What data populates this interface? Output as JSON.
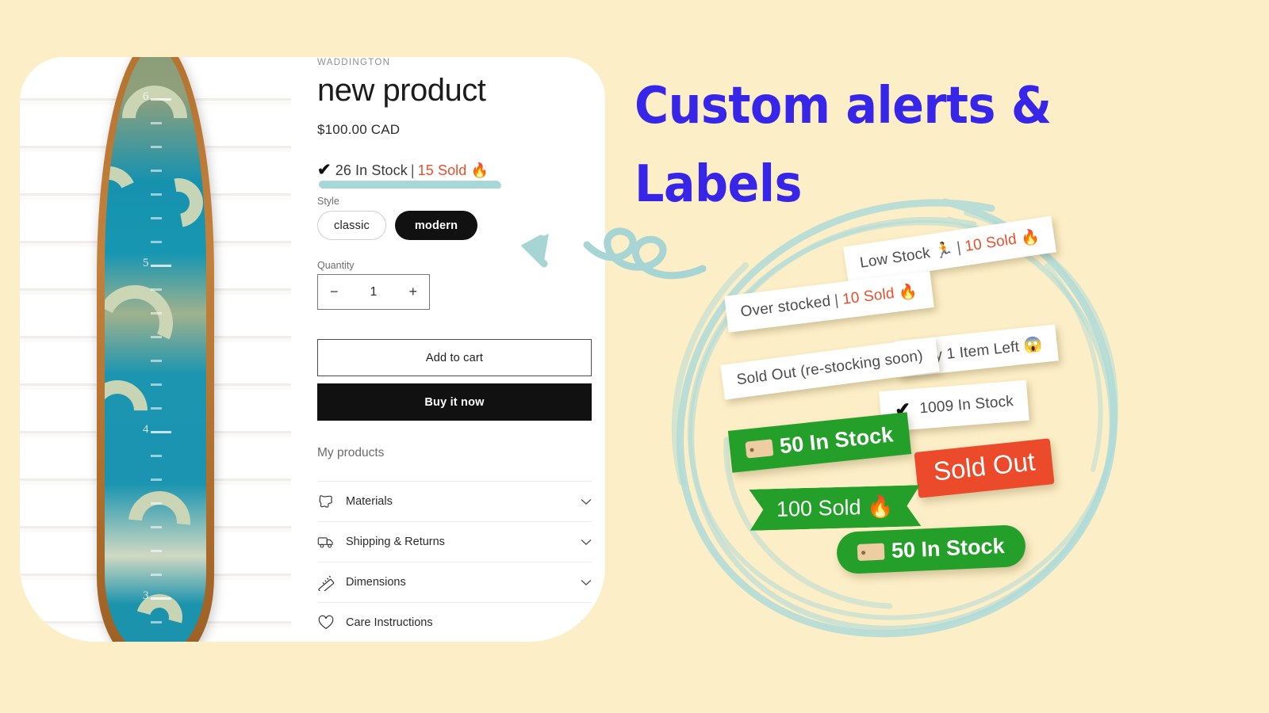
{
  "background_color": "#FCEEC6",
  "heading": {
    "line1": "Custom alerts &",
    "line2": "Labels",
    "color": "#3726E8"
  },
  "product": {
    "vendor": "WADDINGTON",
    "title": "new product",
    "price": "$100.00 CAD",
    "stock_alert": {
      "check_icon": "check-icon",
      "in_stock_text": "26 In Stock",
      "separator": "|",
      "sold_text": "15 Sold",
      "fire_icon": "🔥",
      "sold_color": "#e8502c",
      "underline_color": "#a8d7d7"
    },
    "style": {
      "label": "Style",
      "options": [
        {
          "label": "classic",
          "selected": false
        },
        {
          "label": "modern",
          "selected": true
        }
      ]
    },
    "quantity": {
      "label": "Quantity",
      "value": "1",
      "minus": "−",
      "plus": "+"
    },
    "buttons": {
      "add_to_cart": "Add to cart",
      "buy_it_now": "Buy it now"
    },
    "section_label": "My products",
    "accordion": [
      {
        "label": "Materials",
        "icon": "leather-icon"
      },
      {
        "label": "Shipping & Returns",
        "icon": "truck-icon"
      },
      {
        "label": "Dimensions",
        "icon": "ruler-icon"
      },
      {
        "label": "Care Instructions",
        "icon": "heart-icon"
      }
    ],
    "image": {
      "alt": "surfboard growth chart with wave swirls",
      "ruler_numbers": [
        "6",
        "5",
        "4",
        "3"
      ]
    }
  },
  "badges": [
    {
      "id": "low-stock",
      "style": "white",
      "text": "Low Stock 🏃",
      "separator": "|",
      "highlight": "10 Sold",
      "trailing_icon": "🔥"
    },
    {
      "id": "over-stocked",
      "style": "white",
      "text": "Over stocked",
      "separator": "|",
      "highlight": "10 Sold",
      "trailing_icon": "🔥"
    },
    {
      "id": "only-1-item-left",
      "style": "white",
      "text": "Only 1 Item Left 😱"
    },
    {
      "id": "sold-out-restocking",
      "style": "white",
      "text": "Sold Out (re-stocking soon)"
    },
    {
      "id": "1009-in-stock",
      "style": "white",
      "check_icon": "check-icon",
      "text": "1009 In Stock"
    },
    {
      "id": "50-in-stock-rect",
      "style": "green-rect",
      "tag_icon": "tag-icon",
      "text": "50 In Stock",
      "color": "#24A02A"
    },
    {
      "id": "sold-out",
      "style": "red-rect",
      "text": "Sold Out",
      "color": "#EC4B2B"
    },
    {
      "id": "100-sold",
      "style": "green-ribbon",
      "text": "100 Sold 🔥",
      "color": "#24A02A"
    },
    {
      "id": "50-in-stock-pill",
      "style": "green-pill",
      "tag_icon": "tag-icon",
      "text": "50 In Stock",
      "color": "#24A02A"
    }
  ],
  "decor": {
    "scribble_color": "#AEDAD8",
    "arrow_color": "#A6D5D4"
  }
}
